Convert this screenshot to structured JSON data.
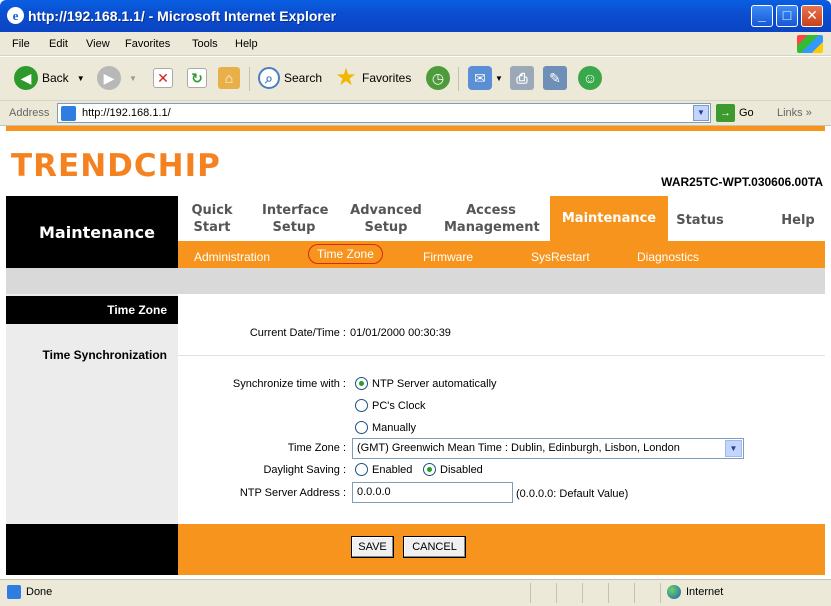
{
  "window": {
    "title": "http://192.168.1.1/ - Microsoft Internet Explorer"
  },
  "menu": {
    "file": "File",
    "edit": "Edit",
    "view": "View",
    "favorites": "Favorites",
    "tools": "Tools",
    "help": "Help"
  },
  "toolbar": {
    "back": "Back",
    "search": "Search",
    "favorites": "Favorites"
  },
  "address": {
    "label": "Address",
    "url": "http://192.168.1.1/",
    "go": "Go",
    "links": "Links"
  },
  "header": {
    "brand": "TRENDCHIP",
    "model": "WAR25TC-WPT.030606.00TA",
    "section": "Maintenance"
  },
  "nav": {
    "tabs": [
      {
        "line1": "Quick",
        "line2": "Start"
      },
      {
        "line1": "Interface",
        "line2": "Setup"
      },
      {
        "line1": "Advanced",
        "line2": "Setup"
      },
      {
        "line1": "Access",
        "line2": "Management"
      },
      {
        "line1": "Maintenance",
        "line2": ""
      },
      {
        "line1": "Status",
        "line2": ""
      },
      {
        "line1": "Help",
        "line2": ""
      }
    ],
    "subtabs": [
      "Administration",
      "Time Zone",
      "Firmware",
      "SysRestart",
      "Diagnostics"
    ]
  },
  "left": {
    "heading": "Time Zone",
    "subheading": "Time Synchronization"
  },
  "form": {
    "current_label": "Current Date/Time :",
    "current_value": "01/01/2000 00:30:39",
    "sync_label": "Synchronize time with :",
    "sync_options": [
      "NTP Server automatically",
      "PC's Clock",
      "Manually"
    ],
    "sync_selected": "NTP Server automatically",
    "timezone_label": "Time Zone :",
    "timezone_value": "(GMT) Greenwich Mean Time : Dublin, Edinburgh, Lisbon, London",
    "daylight_label": "Daylight Saving :",
    "daylight_options": [
      "Enabled",
      "Disabled"
    ],
    "daylight_selected": "Disabled",
    "ntp_label": "NTP Server Address :",
    "ntp_value": "0.0.0.0",
    "ntp_hint": "(0.0.0.0: Default Value)"
  },
  "buttons": {
    "save": "SAVE",
    "cancel": "CANCEL"
  },
  "status": {
    "text": "Done",
    "zone": "Internet"
  },
  "colors": {
    "accent": "#f7941d",
    "titlebar": "#0a4fd0"
  }
}
